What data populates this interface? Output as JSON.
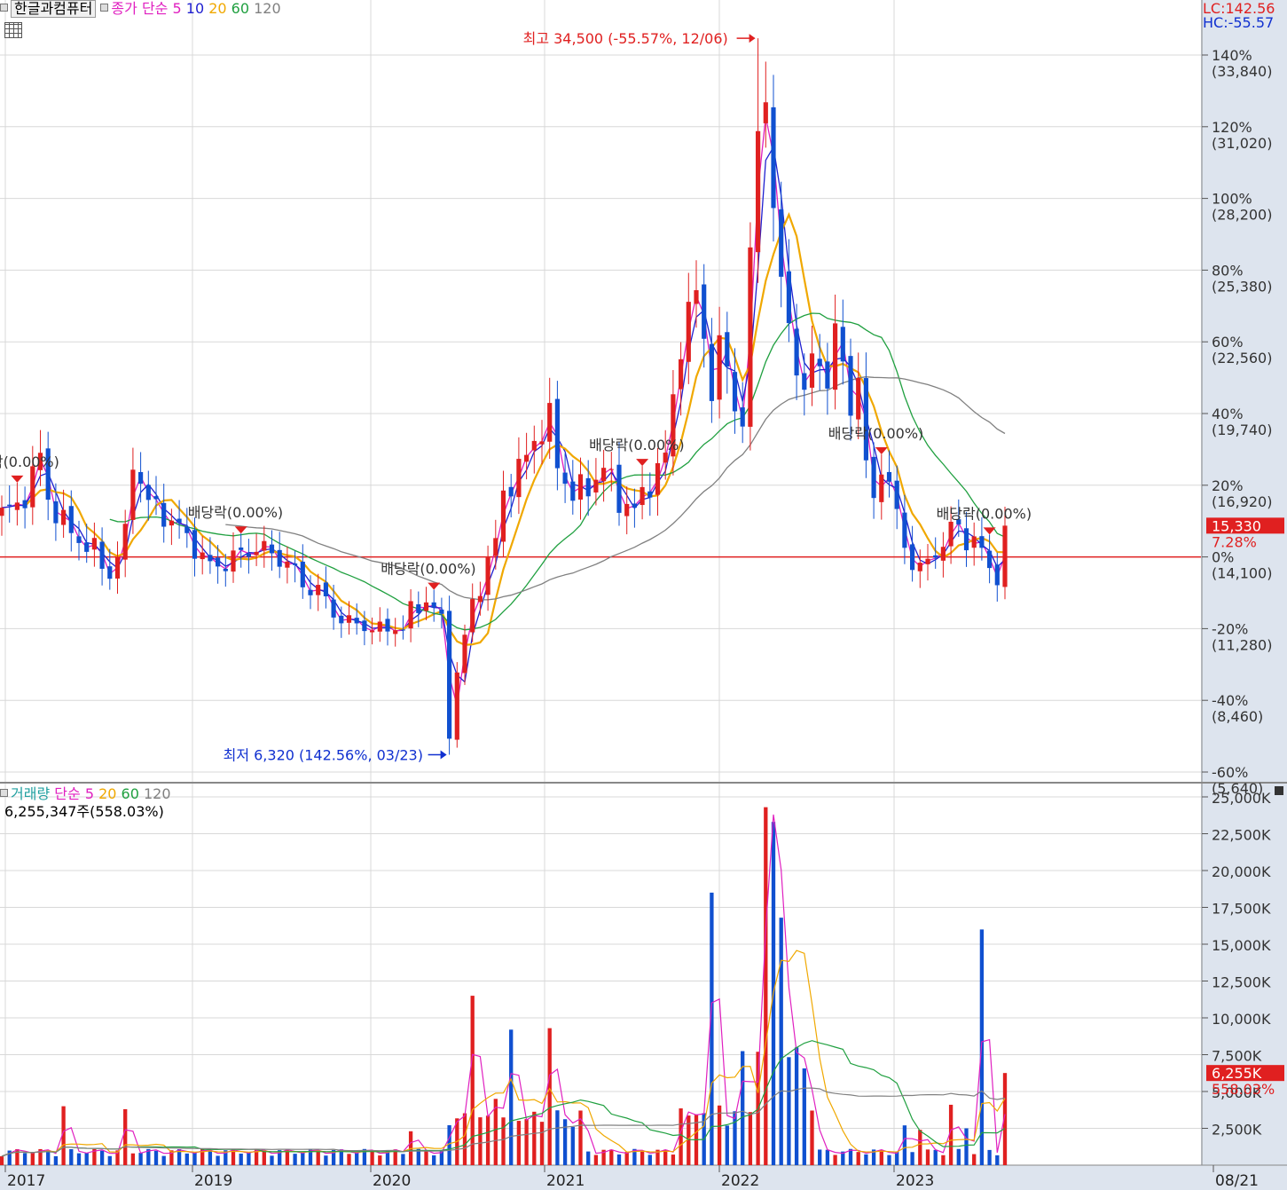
{
  "header": {
    "stock_name": "한글과컴퓨터",
    "price_label": "종가 단순",
    "ma_periods": [
      "5",
      "10",
      "20",
      "60",
      "120"
    ],
    "lc": "LC:142.56",
    "hc": "HC:-55.57",
    "colors": {
      "ma5": "#e020c0",
      "ma10": "#2020d0",
      "ma20": "#f0a800",
      "ma60": "#20a040",
      "ma120": "#808080"
    }
  },
  "volume_header": {
    "label": "거래량",
    "ma_label": "단순",
    "ma_periods": [
      "5",
      "20",
      "60",
      "120"
    ],
    "current": "6,255,347주(558.03%)"
  },
  "annotations": {
    "high": "최고 34,500 (-55.57%, 12/06)",
    "low": "최저 6,320 (142.56%, 03/23)",
    "ex_dividend": "배당락(0.00%)"
  },
  "current_price": {
    "price": "15,330",
    "change": "7.28%"
  },
  "current_volume": {
    "value": "6,255K",
    "change": "558.03%"
  },
  "chart_data": [
    {
      "type": "candlestick",
      "title": "한글과컴퓨터",
      "x_labels": [
        "2017",
        "2019",
        "2020",
        "2021",
        "2022",
        "2023",
        "08/21"
      ],
      "ylim": [
        5640,
        35000
      ],
      "y_ticks": [
        {
          "pct": "140%",
          "price": "(33,840)"
        },
        {
          "pct": "120%",
          "price": "(31,020)"
        },
        {
          "pct": "100%",
          "price": "(28,200)"
        },
        {
          "pct": "80%",
          "price": "(25,380)"
        },
        {
          "pct": "60%",
          "price": "(22,560)"
        },
        {
          "pct": "40%",
          "price": "(19,740)"
        },
        {
          "pct": "20%",
          "price": "(16,920)"
        },
        {
          "pct": "0%",
          "price": "(14,100)"
        },
        {
          "pct": "-20%",
          "price": "(11,280)"
        },
        {
          "pct": "-40%",
          "price": "(8,460)"
        },
        {
          "pct": "-60%",
          "price": "(5,640)"
        }
      ],
      "reference_price": 14100,
      "high": 34500,
      "low": 6320,
      "last_close": 15330,
      "price_anchors": [
        [
          0,
          15800
        ],
        [
          2,
          16100
        ],
        [
          4,
          17200
        ],
        [
          5,
          18100
        ],
        [
          6,
          16400
        ],
        [
          8,
          15400
        ],
        [
          10,
          14800
        ],
        [
          12,
          14300
        ],
        [
          14,
          13400
        ],
        [
          16,
          14900
        ],
        [
          17,
          18000
        ],
        [
          19,
          16200
        ],
        [
          21,
          15800
        ],
        [
          24,
          14900
        ],
        [
          27,
          13700
        ],
        [
          29,
          13900
        ],
        [
          31,
          14200
        ],
        [
          33,
          14500
        ],
        [
          35,
          14200
        ],
        [
          37,
          13900
        ],
        [
          39,
          13000
        ],
        [
          41,
          12800
        ],
        [
          43,
          11900
        ],
        [
          45,
          11500
        ],
        [
          47,
          11400
        ],
        [
          49,
          11200
        ],
        [
          51,
          11400
        ],
        [
          52,
          11200
        ],
        [
          53,
          12000
        ],
        [
          55,
          12400
        ],
        [
          56,
          12000
        ],
        [
          57,
          11600
        ],
        [
          58,
          7200
        ],
        [
          59,
          9500
        ],
        [
          61,
          12300
        ],
        [
          63,
          13800
        ],
        [
          64,
          14700
        ],
        [
          65,
          16700
        ],
        [
          67,
          17400
        ],
        [
          69,
          18800
        ],
        [
          71,
          19400
        ],
        [
          72,
          17800
        ],
        [
          74,
          16500
        ],
        [
          76,
          16900
        ],
        [
          78,
          17600
        ],
        [
          80,
          16400
        ],
        [
          82,
          15900
        ],
        [
          84,
          17100
        ],
        [
          86,
          18000
        ],
        [
          88,
          22700
        ],
        [
          90,
          24400
        ],
        [
          91,
          22800
        ],
        [
          92,
          20800
        ],
        [
          93,
          22100
        ],
        [
          94,
          21600
        ],
        [
          95,
          20100
        ],
        [
          96,
          19500
        ],
        [
          97,
          25400
        ],
        [
          98,
          31200
        ],
        [
          99,
          32500
        ],
        [
          100,
          27800
        ],
        [
          101,
          24400
        ],
        [
          102,
          23800
        ],
        [
          103,
          21500
        ],
        [
          104,
          20400
        ],
        [
          105,
          21700
        ],
        [
          106,
          22200
        ],
        [
          107,
          20800
        ],
        [
          108,
          22800
        ],
        [
          109,
          21700
        ],
        [
          110,
          20200
        ],
        [
          111,
          21000
        ],
        [
          112,
          17500
        ],
        [
          113,
          16600
        ],
        [
          114,
          17700
        ],
        [
          115,
          16800
        ],
        [
          116,
          15700
        ],
        [
          117,
          14800
        ],
        [
          118,
          13700
        ],
        [
          119,
          13600
        ],
        [
          120,
          13900
        ],
        [
          121,
          14500
        ],
        [
          122,
          14400
        ],
        [
          123,
          15200
        ],
        [
          124,
          15400
        ],
        [
          125,
          14800
        ],
        [
          126,
          14600
        ],
        [
          127,
          14300
        ],
        [
          128,
          13800
        ],
        [
          129,
          13300
        ],
        [
          130,
          15330
        ]
      ],
      "dividend_markers": [
        2,
        31,
        56,
        83,
        114,
        128
      ]
    },
    {
      "type": "bar",
      "title": "거래량",
      "ylim": [
        0,
        25000
      ],
      "unit": "K",
      "y_ticks": [
        "25,000K",
        "22,500K",
        "20,000K",
        "17,500K",
        "15,000K",
        "12,500K",
        "10,000K",
        "7,500K",
        "5,000K",
        "2,500K"
      ],
      "spikes": [
        [
          8,
          4000
        ],
        [
          16,
          3800
        ],
        [
          53,
          2300
        ],
        [
          61,
          11500
        ],
        [
          64,
          4500
        ],
        [
          66,
          9200
        ],
        [
          71,
          9300
        ],
        [
          99,
          24300
        ],
        [
          100,
          23300
        ],
        [
          101,
          16800
        ],
        [
          117,
          2700
        ],
        [
          119,
          2400
        ],
        [
          123,
          4100
        ],
        [
          125,
          2500
        ],
        [
          127,
          16000
        ],
        [
          130,
          6255
        ],
        [
          92,
          18500
        ],
        [
          97,
          3600
        ]
      ]
    }
  ]
}
